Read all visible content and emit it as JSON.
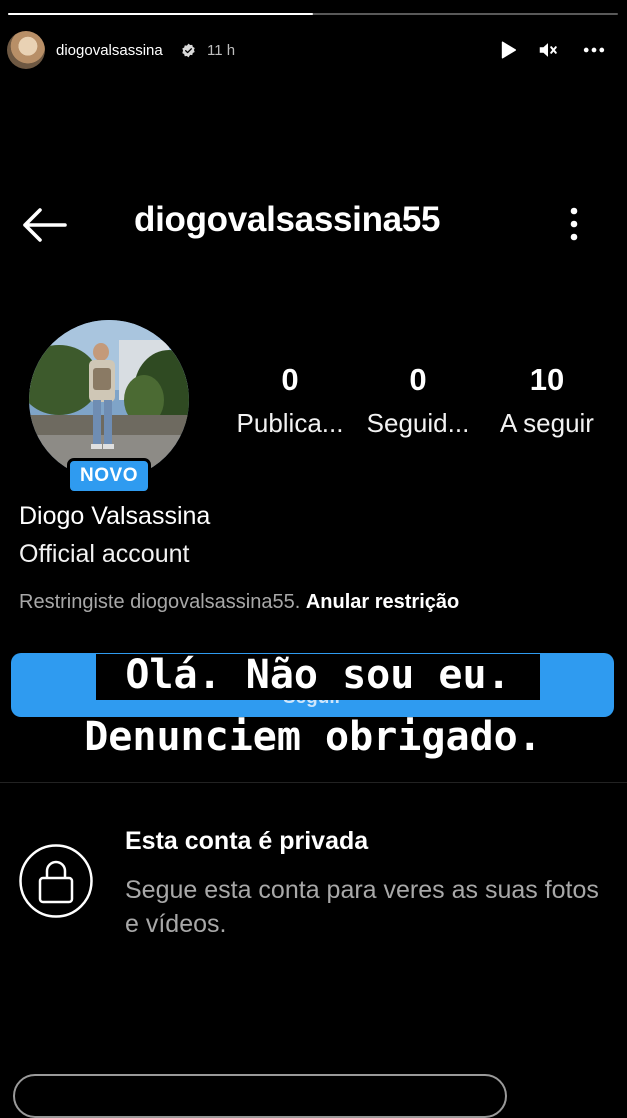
{
  "story": {
    "progress": 0.5,
    "username": "diogovalsassina",
    "time": "11 h",
    "icons": [
      "play-icon",
      "mute-icon",
      "more-icon",
      "verified-icon"
    ]
  },
  "profile": {
    "username": "diogovalsassina55",
    "badge": "NOVO",
    "stats": [
      {
        "value": "0",
        "label": "Publica..."
      },
      {
        "value": "0",
        "label": "Seguid..."
      },
      {
        "value": "10",
        "label": "A seguir"
      }
    ],
    "display_name": "Diogo Valsassina",
    "bio": "Official account",
    "restrict_text": "Restringiste diogovalsassina55.",
    "restrict_action": "Anular restrição",
    "follow_button": "Seguir"
  },
  "overlay": {
    "line1": "Olá. Não sou eu.",
    "line2": "Denunciem obrigado."
  },
  "private": {
    "title": "Esta conta é privada",
    "description": "Segue esta conta para veres as suas fotos e vídeos."
  },
  "colors": {
    "accent": "#2f9bf0",
    "background": "#000000",
    "muted_text": "#a8a8a8"
  }
}
